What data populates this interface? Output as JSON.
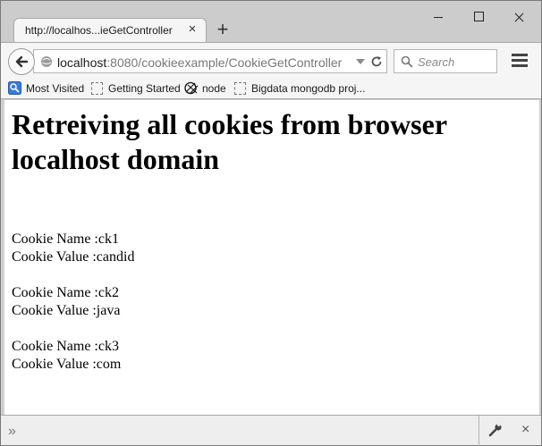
{
  "tab": {
    "title": "http://localhos...ieGetController",
    "close": "×",
    "new_tab": "+"
  },
  "urlbar": {
    "host": "localhost",
    "rest": ":8080/cookieexample/CookieGetController"
  },
  "search": {
    "placeholder": "Search"
  },
  "bookmarks": [
    {
      "label": "Most Visited",
      "icon": "most-visited-icon"
    },
    {
      "label": "Getting Started",
      "icon": "page-icon"
    },
    {
      "label": "node",
      "icon": "node-icon"
    },
    {
      "label": "Bigdata mongodb proj...",
      "icon": "page-icon"
    }
  ],
  "page": {
    "heading": "Retreiving all cookies from browser localhost domain",
    "cookies": [
      {
        "name_line": "Cookie Name :ck1",
        "value_line": "Cookie Value :candid"
      },
      {
        "name_line": "Cookie Name :ck2",
        "value_line": "Cookie Value :java"
      },
      {
        "name_line": "Cookie Name :ck3",
        "value_line": "Cookie Value :com"
      }
    ]
  },
  "bottombar": {
    "overflow": "»",
    "close": "×"
  },
  "icons": [
    "back-arrow-icon",
    "globe-icon",
    "dropmarker-icon",
    "reload-icon",
    "search-icon",
    "menu-icon",
    "wrench-icon",
    "close-icon"
  ]
}
